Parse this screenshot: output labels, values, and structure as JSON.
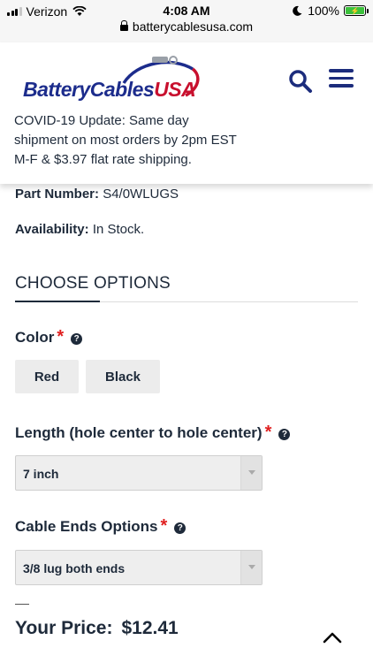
{
  "status_bar": {
    "carrier": "Verizon",
    "time": "4:08 AM",
    "battery": "100%",
    "url": "batterycablesusa.com"
  },
  "header": {
    "logo_text": "BatteryCables",
    "logo_text_usa": "USA",
    "covid_notice": "COVID-19 Update: Same day shipment on most orders by 2pm EST M-F & $3.97 flat rate shipping."
  },
  "product": {
    "part_number_label": "Part Number:",
    "part_number": "S4/0WLUGS",
    "availability_label": "Availability:",
    "availability": "In Stock."
  },
  "options": {
    "heading": "CHOOSE OPTIONS",
    "color": {
      "label": "Color",
      "required": "*",
      "help": "?",
      "choices": [
        "Red",
        "Black"
      ]
    },
    "length": {
      "label": "Length (hole center to hole center)",
      "required": "*",
      "help": "?",
      "selected": "7 inch"
    },
    "cable_ends": {
      "label": "Cable Ends Options",
      "required": "*",
      "help": "?",
      "selected": "3/8 lug both ends"
    }
  },
  "price": {
    "label": "Your Price:",
    "value": "$12.41"
  },
  "colors": {
    "brand_blue": "#1c2c8c",
    "brand_red": "#c8102e",
    "required_red": "#e02020",
    "text": "#1e2a3a"
  }
}
